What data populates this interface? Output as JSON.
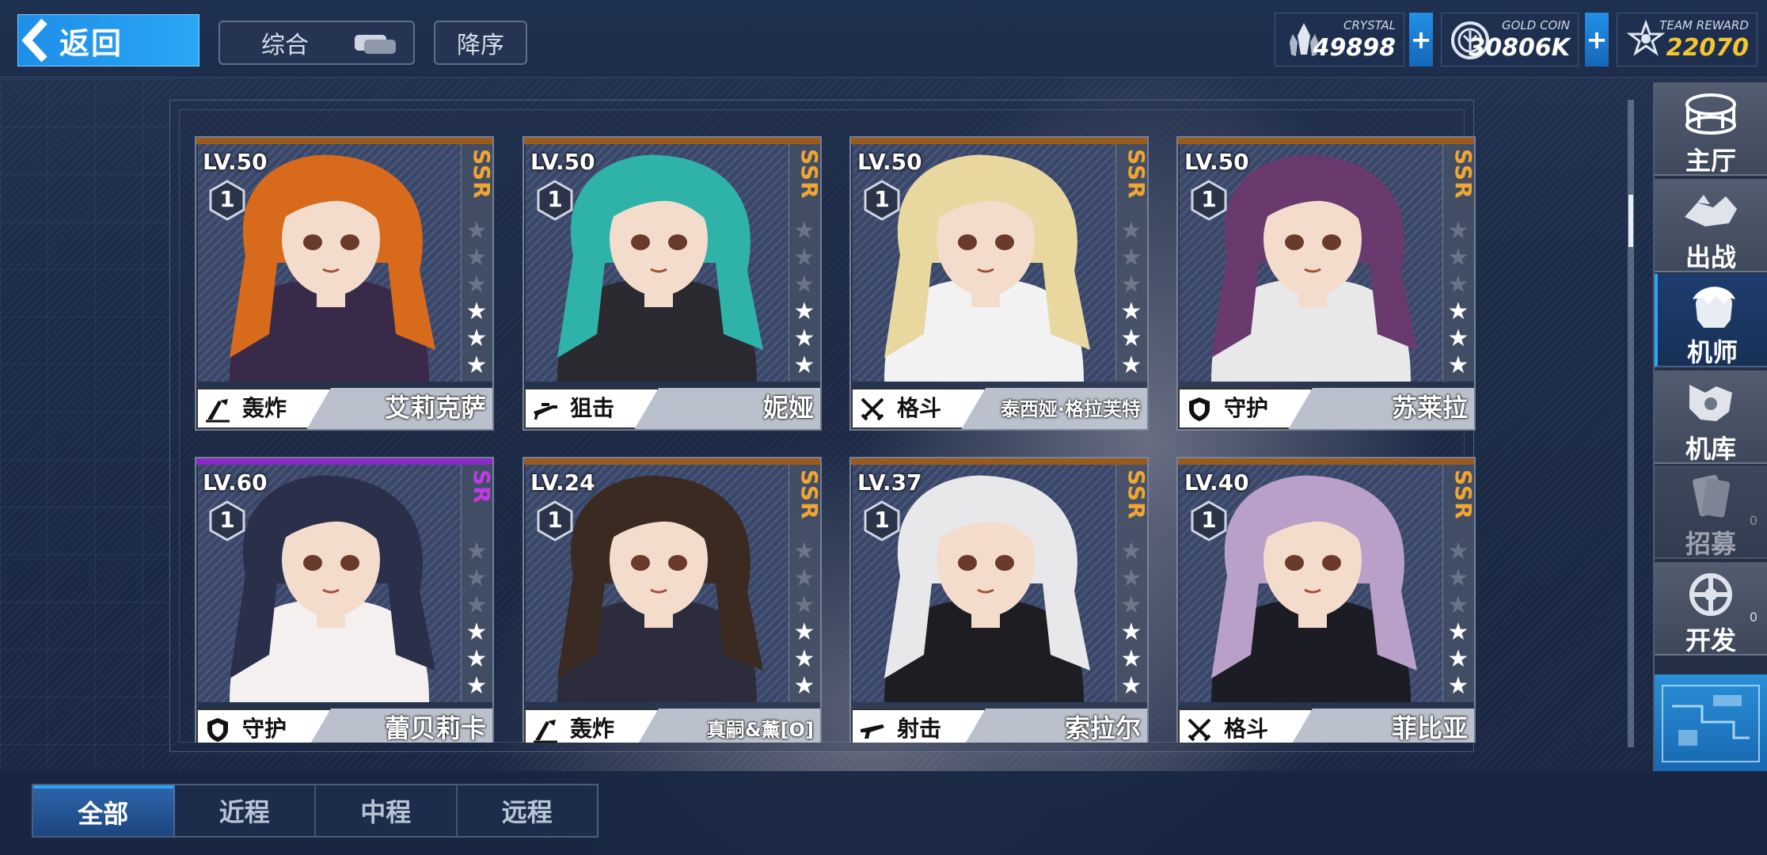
{
  "topbar": {
    "back_label": "返回",
    "sort_label": "综合",
    "order_label": "降序",
    "currencies": [
      {
        "label": "CRYSTAL",
        "value": "49898",
        "icon": "crystal-icon"
      },
      {
        "label": "GOLD COIN",
        "value": "30806K",
        "icon": "gold-coin-icon"
      },
      {
        "label": "TEAM REWARD",
        "value": "22070",
        "icon": "team-reward-icon"
      }
    ],
    "plus_label": "+"
  },
  "colors": {
    "accent": "#2aa6f5",
    "ssr": "#f2a531",
    "sr": "#c23ae8",
    "team_reward_value": "#f5c630"
  },
  "pilots": [
    {
      "level": "LV.50",
      "rarity": "SSR",
      "rank": "1",
      "stars": 3,
      "role": "轰炸",
      "role_icon": "bomb-icon",
      "name": "艾莉克萨"
    },
    {
      "level": "LV.50",
      "rarity": "SSR",
      "rank": "1",
      "stars": 3,
      "role": "狙击",
      "role_icon": "sniper-icon",
      "name": "妮娅"
    },
    {
      "level": "LV.50",
      "rarity": "SSR",
      "rank": "1",
      "stars": 3,
      "role": "格斗",
      "role_icon": "swords-icon",
      "name": "泰西娅·格拉芙特"
    },
    {
      "level": "LV.50",
      "rarity": "SSR",
      "rank": "1",
      "stars": 3,
      "role": "守护",
      "role_icon": "shield-icon",
      "name": "苏莱拉"
    },
    {
      "level": "LV.60",
      "rarity": "SR",
      "rank": "1",
      "stars": 3,
      "role": "守护",
      "role_icon": "shield-icon",
      "name": "蕾贝莉卡"
    },
    {
      "level": "LV.24",
      "rarity": "SSR",
      "rank": "1",
      "stars": 3,
      "role": "轰炸",
      "role_icon": "bomb-icon",
      "name": "真嗣&薰[O]"
    },
    {
      "level": "LV.37",
      "rarity": "SSR",
      "rank": "1",
      "stars": 3,
      "role": "射击",
      "role_icon": "rifle-icon",
      "name": "索拉尔"
    },
    {
      "level": "LV.40",
      "rarity": "SSR",
      "rank": "1",
      "stars": 3,
      "role": "格斗",
      "role_icon": "swords-icon",
      "name": "菲比亚"
    }
  ],
  "nav": [
    {
      "label": "主厅",
      "icon": "hall-icon",
      "active": false
    },
    {
      "label": "出战",
      "icon": "battle-icon",
      "active": false
    },
    {
      "label": "机师",
      "icon": "pilot-icon",
      "active": true
    },
    {
      "label": "机库",
      "icon": "hangar-icon",
      "active": false
    },
    {
      "label": "招募",
      "icon": "recruit-icon",
      "active": false,
      "count": "0"
    },
    {
      "label": "开发",
      "icon": "develop-icon",
      "active": false,
      "count": "0"
    }
  ],
  "tabs": [
    {
      "label": "全部",
      "active": true
    },
    {
      "label": "近程",
      "active": false
    },
    {
      "label": "中程",
      "active": false
    },
    {
      "label": "远程",
      "active": false
    }
  ]
}
